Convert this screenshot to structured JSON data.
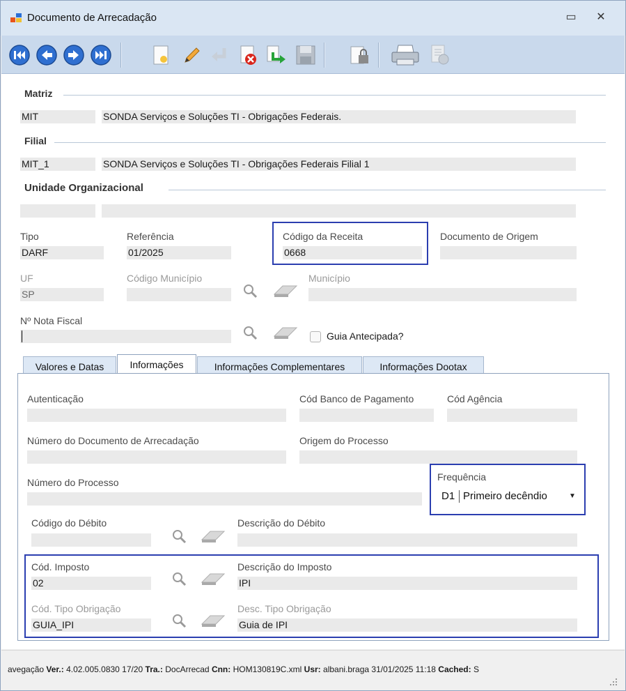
{
  "window": {
    "title": "Documento de Arrecadação",
    "minimize_glyph": "▭",
    "close_glyph": "✕"
  },
  "toolbar": {
    "buttons": [
      {
        "name": "first-record-button",
        "icon": "first-icon"
      },
      {
        "name": "previous-record-button",
        "icon": "previous-icon"
      },
      {
        "name": "next-record-button",
        "icon": "next-icon"
      },
      {
        "name": "last-record-button",
        "icon": "last-icon"
      },
      {
        "name": "new-button",
        "icon": "new-document-icon"
      },
      {
        "name": "edit-button",
        "icon": "pencil-icon"
      },
      {
        "name": "undo-button",
        "icon": "undo-icon"
      },
      {
        "name": "delete-button",
        "icon": "delete-icon"
      },
      {
        "name": "confirm-button",
        "icon": "confirm-arrow-icon"
      },
      {
        "name": "save-button",
        "icon": "floppy-icon"
      },
      {
        "name": "lock-button",
        "icon": "lock-icon"
      },
      {
        "name": "print-button",
        "icon": "printer-icon"
      },
      {
        "name": "report-button",
        "icon": "report-icon"
      }
    ]
  },
  "matriz": {
    "label": "Matriz",
    "code": "MIT",
    "description": "SONDA Serviços e Soluções TI - Obrigações Federais."
  },
  "filial": {
    "label": "Filial",
    "code": "MIT_1",
    "description": "SONDA Serviços e Soluções TI - Obrigações Federais Filial 1"
  },
  "unidade": {
    "label": "Unidade Organizacional",
    "code": "",
    "description": ""
  },
  "header_fields": {
    "tipo": {
      "label": "Tipo",
      "value": "DARF"
    },
    "referencia": {
      "label": "Referência",
      "value": "01/2025"
    },
    "codigo_receita": {
      "label": "Código da Receita",
      "value": "0668"
    },
    "documento_origem": {
      "label": "Documento de Origem",
      "value": ""
    },
    "uf": {
      "label": "UF",
      "value": "SP"
    },
    "codigo_municipio": {
      "label": "Código Município",
      "value": ""
    },
    "municipio": {
      "label": "Município",
      "value": ""
    },
    "nota_fiscal": {
      "label": "Nº Nota Fiscal",
      "value": ""
    },
    "guia_antecipada": {
      "label": "Guia Antecipada?",
      "checked": false
    }
  },
  "tabs": [
    {
      "label": "Valores e Datas",
      "active": false
    },
    {
      "label": "Informações",
      "active": true
    },
    {
      "label": "Informações Complementares",
      "active": false
    },
    {
      "label": "Informações Dootax",
      "active": false
    }
  ],
  "info_tab": {
    "autenticacao": {
      "label": "Autenticação",
      "value": ""
    },
    "cod_banco": {
      "label": "Cód Banco de Pagamento",
      "value": ""
    },
    "cod_agencia": {
      "label": "Cód Agência",
      "value": ""
    },
    "numero_documento": {
      "label": "Número do Documento de Arrecadação",
      "value": ""
    },
    "origem_processo": {
      "label": "Origem do Processo",
      "value": ""
    },
    "numero_processo": {
      "label": "Número do Processo",
      "value": ""
    },
    "frequencia": {
      "label": "Frequência",
      "code": "D1",
      "text": "Primeiro decêndio"
    },
    "codigo_debito": {
      "label": "Código do Débito",
      "value": ""
    },
    "descricao_debito": {
      "label": "Descrição do Débito",
      "value": ""
    },
    "cod_imposto": {
      "label": "Cód. Imposto",
      "value": "02"
    },
    "descricao_imposto": {
      "label": "Descrição do Imposto",
      "value": "IPI"
    },
    "cod_tipo_obrigacao": {
      "label": "Cód. Tipo Obrigação",
      "value": "GUIA_IPI"
    },
    "desc_tipo_obrigacao": {
      "label": "Desc. Tipo Obrigação",
      "value": "Guia de IPI"
    }
  },
  "status": {
    "prefix": "avegação",
    "ver_label": "Ver.:",
    "ver_value": "4.02.005.0830 17/20",
    "tra_label": "Tra.:",
    "tra_value": "DocArrecad",
    "cnn_label": "Cnn:",
    "cnn_value": "HOM130819C.xml",
    "usr_label": "Usr:",
    "usr_value": "albani.braga 31/01/2025 11:18",
    "cached_label": "Cached:",
    "cached_value": "S"
  }
}
